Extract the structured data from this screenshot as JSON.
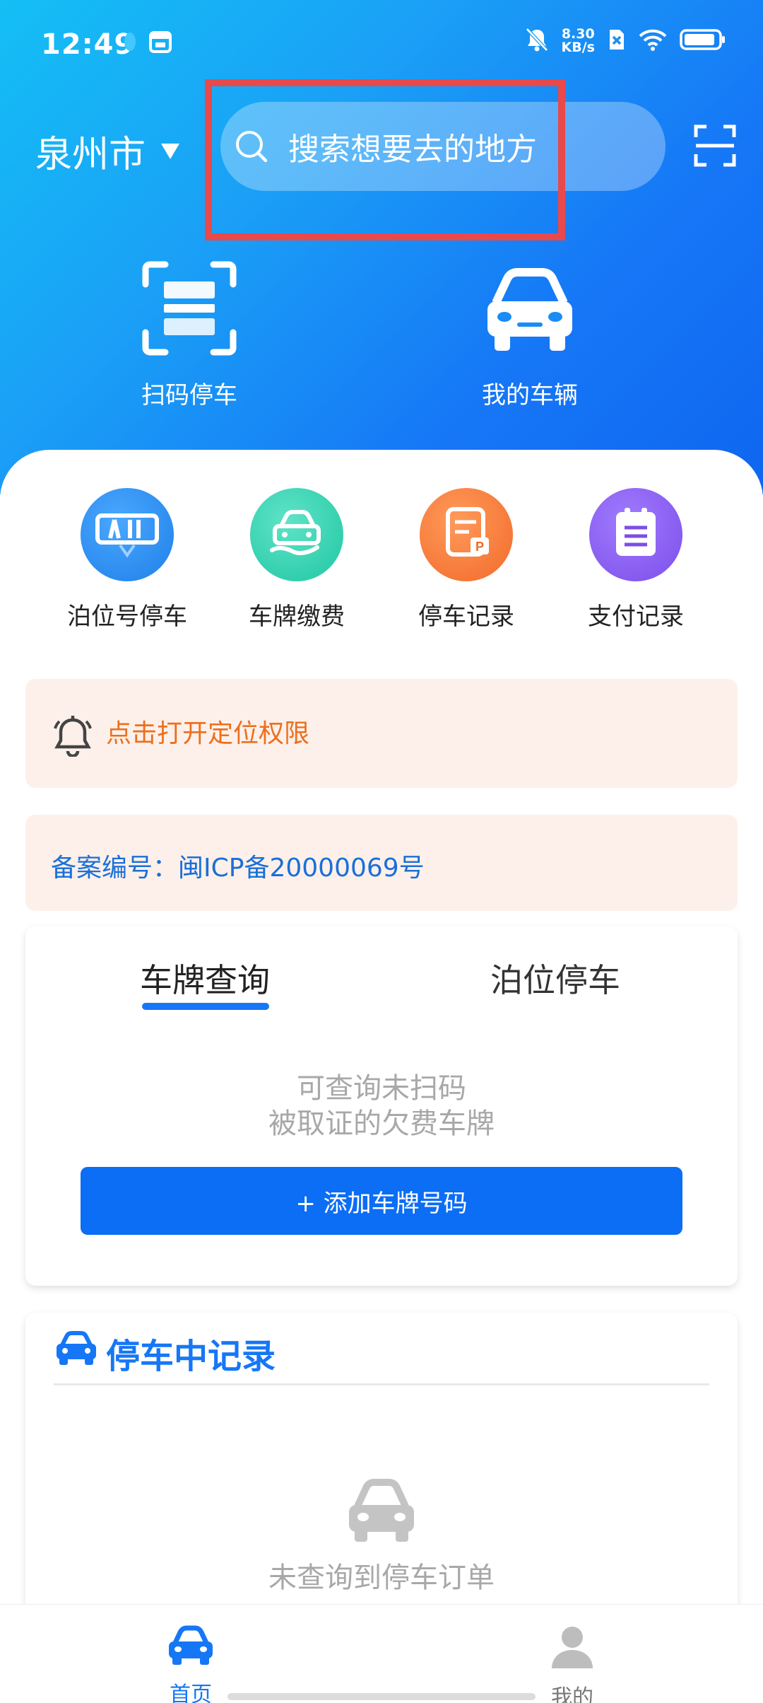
{
  "status_bar": {
    "time": "12:49",
    "net_speed_value": "8.30",
    "net_speed_unit": "KB/s",
    "icons": [
      "notification-dot-icon",
      "calendar-icon",
      "bell-muted-icon",
      "sim-x-icon",
      "wifi-icon",
      "battery-icon"
    ]
  },
  "header": {
    "city": "泉州市",
    "search_placeholder": "搜索想要去的地方",
    "scan_icon": "scan-frame-icon"
  },
  "hero_actions": [
    {
      "label": "扫码停车",
      "icon": "scan-qr-icon"
    },
    {
      "label": "我的车辆",
      "icon": "car-icon"
    }
  ],
  "quick_actions": [
    {
      "label": "泊位号停车",
      "icon": "berth-number-icon",
      "color": "#2f8ef2"
    },
    {
      "label": "车牌缴费",
      "icon": "car-pay-icon",
      "color": "#2fd2b2"
    },
    {
      "label": "停车记录",
      "icon": "parking-record-icon",
      "color": "#f97a3a"
    },
    {
      "label": "支付记录",
      "icon": "payment-record-icon",
      "color": "#8a5cf0"
    }
  ],
  "location_notice": {
    "text": "点击打开定位权限",
    "color": "#ec6f1d",
    "icon": "bell-icon"
  },
  "icp_notice": {
    "text": "备案编号：闽ICP备20000069号",
    "color": "#1a6fd8"
  },
  "plate_card": {
    "tabs": [
      {
        "label": "车牌查询",
        "active": true
      },
      {
        "label": "泊位停车",
        "active": false
      }
    ],
    "empty_line1": "可查询未扫码",
    "empty_line2": "被取证的欠费车牌",
    "add_button": "+ 添加车牌号码"
  },
  "parking_card": {
    "title": "停车中记录",
    "empty_text": "未查询到停车订单"
  },
  "bottom_nav": [
    {
      "label": "首页",
      "active": true,
      "icon": "home-car-icon"
    },
    {
      "label": "我的",
      "active": false,
      "icon": "user-icon"
    }
  ],
  "colors": {
    "primary": "#1677f6",
    "accent_button": "#0c6df5",
    "highlight_box": "#e8494a"
  }
}
